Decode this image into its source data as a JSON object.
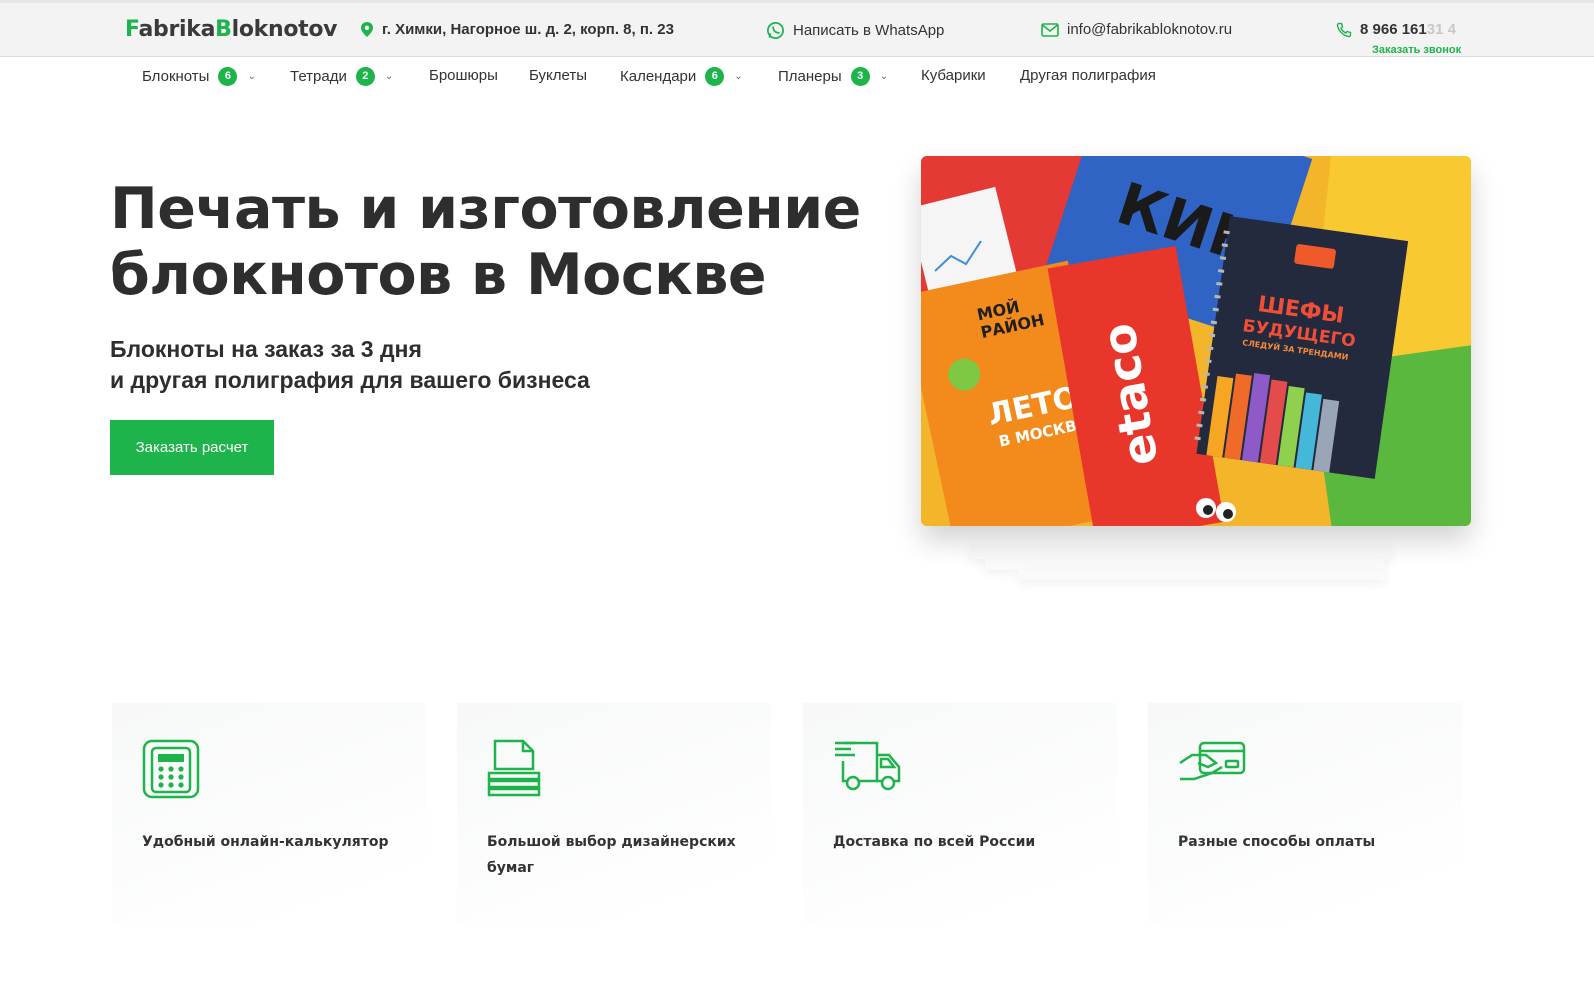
{
  "brand": {
    "part1": "F",
    "part2": "abrika",
    "part3": "B",
    "part4": "loknotov"
  },
  "topbar": {
    "address": "г. Химки, Нагорное ш. д. 2, корп. 8, п. 23",
    "whatsapp": "Написать в WhatsApp",
    "email": "info@fabrikabloknotov.ru",
    "phone_visible": "8 966 161 ",
    "phone_faded": "31 4",
    "callback": "Заказать звонок"
  },
  "nav": [
    {
      "label": "Блокноты",
      "badge": "6",
      "dropdown": true
    },
    {
      "label": "Тетради",
      "badge": "2",
      "dropdown": true
    },
    {
      "label": "Брошюры",
      "badge": "",
      "dropdown": false
    },
    {
      "label": "Буклеты",
      "badge": "",
      "dropdown": false
    },
    {
      "label": "Календари",
      "badge": "6",
      "dropdown": true
    },
    {
      "label": "Планеры",
      "badge": "3",
      "dropdown": true
    },
    {
      "label": "Кубарики",
      "badge": "",
      "dropdown": false
    },
    {
      "label": "Другая полиграфия",
      "badge": "",
      "dropdown": false
    }
  ],
  "hero": {
    "title_line1": "Печать и изготовление",
    "title_line2": "блокнотов в Москве",
    "subtitle_line1": "Блокноты на заказ за 3 дня",
    "subtitle_line2": "и другая полиграфия для вашего бизнеса",
    "cta": "Заказать расчет"
  },
  "image_text": {
    "t1": "КИНО",
    "t2": "etaco",
    "t3": "ШЕФЫ",
    "t4": "БУДУЩЕГО",
    "t5": "СЛЕДУЙ ЗА ТРЕНДАМИ",
    "t6": "МОЙ",
    "t7": "РАЙОН",
    "t8": "ЛЕТО",
    "t9": "В МОСКВЕ"
  },
  "features": [
    {
      "icon": "calculator-icon",
      "text": "Удобный онлайн-калькулятор"
    },
    {
      "icon": "paper-stack-icon",
      "text": "Большой выбор дизайнерских бумаг"
    },
    {
      "icon": "delivery-truck-icon",
      "text": "Доставка по всей России"
    },
    {
      "icon": "card-payment-icon",
      "text": "Разные способы оплаты"
    }
  ],
  "colors": {
    "accent": "#1db44b",
    "text": "#2e2e2e",
    "topbar_bg": "#f3f3f3"
  }
}
